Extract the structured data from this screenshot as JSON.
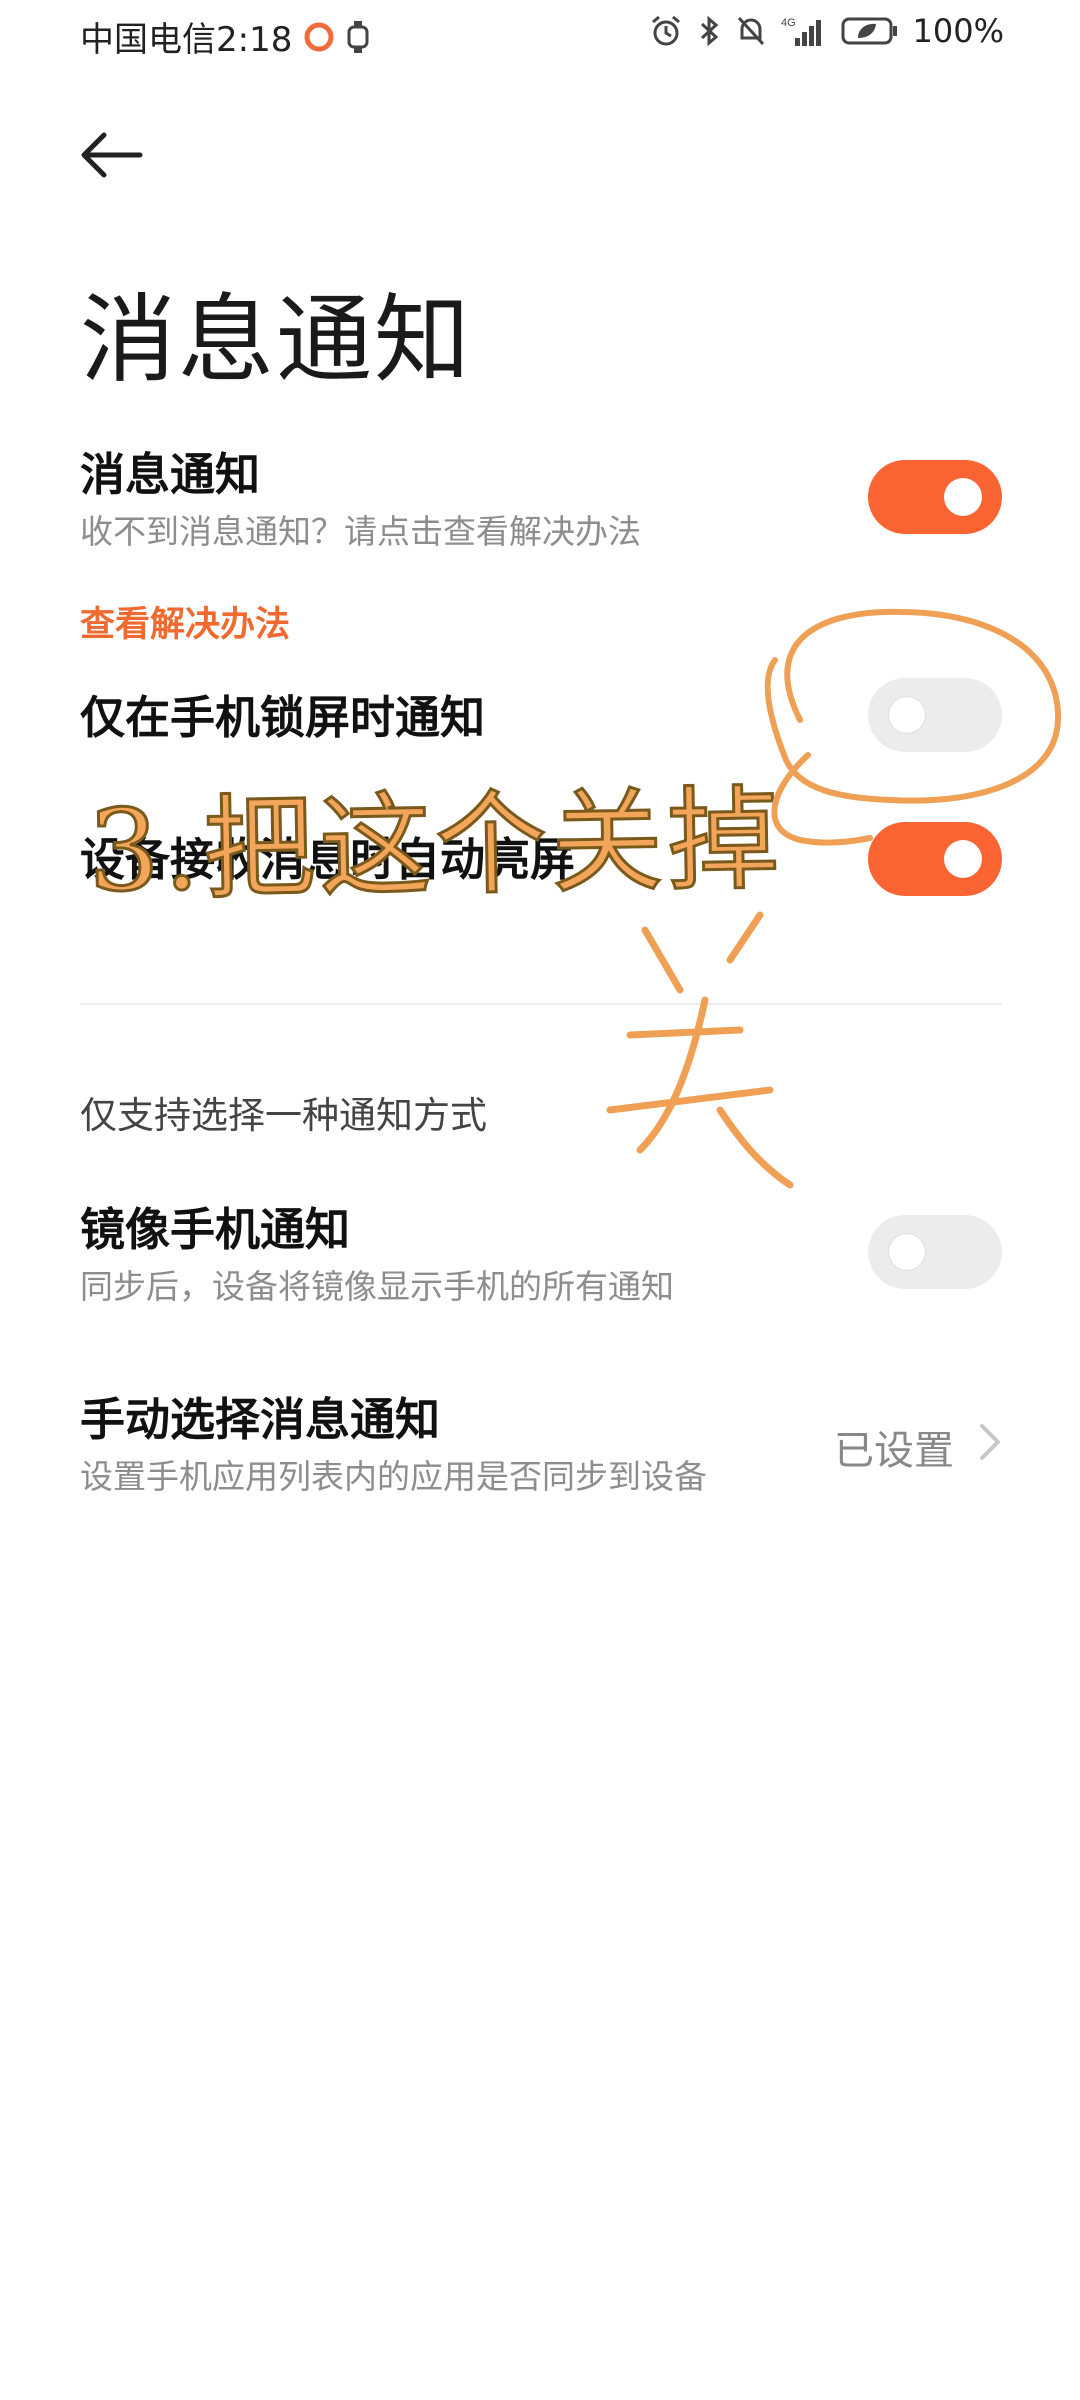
{
  "status_bar": {
    "carrier_time": "中国电信2:18",
    "battery": "100%",
    "network": "4G"
  },
  "header": {
    "title": "消息通知"
  },
  "rows": {
    "notifications": {
      "title": "消息通知",
      "subtitle": "收不到消息通知？请点击查看解决办法",
      "state": "on"
    },
    "solution_link": "查看解决办法",
    "lockscreen_only": {
      "title": "仅在手机锁屏时通知",
      "state": "off"
    },
    "wake_screen": {
      "title": "设备接收消息时自动亮屏",
      "state": "on"
    },
    "section_label": "仅支持选择一种通知方式",
    "mirror": {
      "title": "镜像手机通知",
      "subtitle": "同步后，设备将镜像显示手机的所有通知",
      "state": "off"
    },
    "manual": {
      "title": "手动选择消息通知",
      "subtitle": "设置手机应用列表内的应用是否同步到设备",
      "value": "已设置"
    }
  },
  "annotation": {
    "text": "3.把这个关掉",
    "side_text": "关"
  },
  "colors": {
    "accent": "#fa6432",
    "link": "#f06a30",
    "annotation": "#f3a55a"
  }
}
